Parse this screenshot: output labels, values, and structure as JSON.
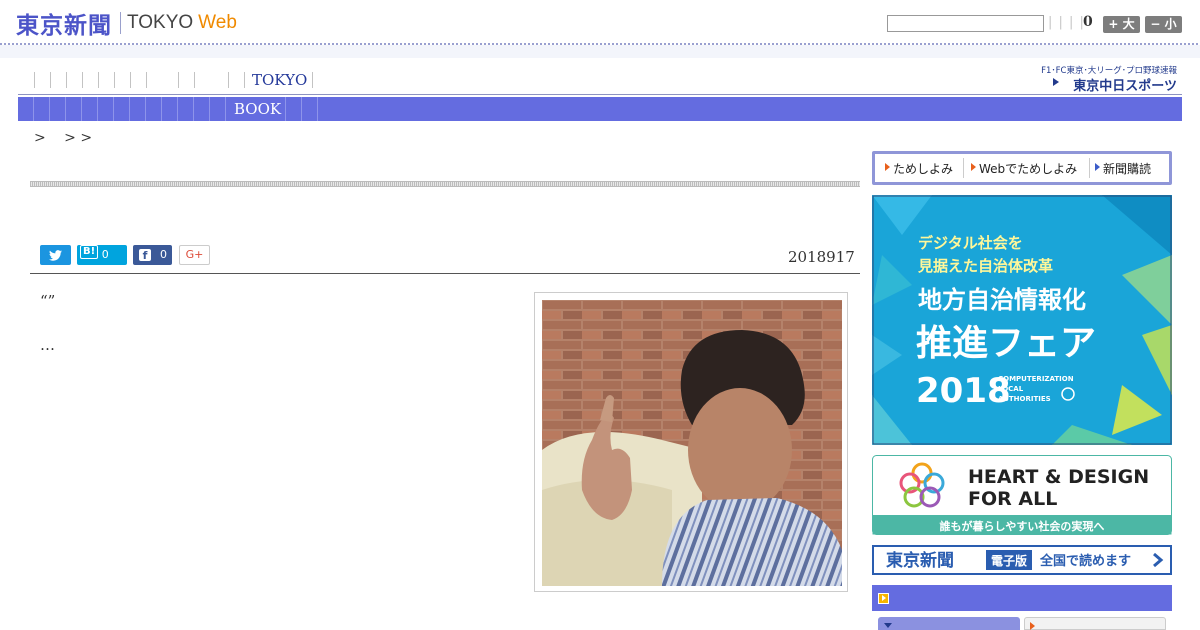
{
  "header": {
    "logo_kanji": "東京新聞",
    "logo_tokyo": "TOKYO",
    "logo_web": "Web",
    "search_placeholder": "",
    "bars": "| | | |",
    "count": "0",
    "font_up_label": "+ 大",
    "font_down_label": "− 小"
  },
  "nav": {
    "tokyo_label": "TOKYO",
    "book_label": "BOOK",
    "sports_line1": "F1･FC東京･大リーグ･プロ野球速報",
    "sports_line2": "東京中日スポーツ"
  },
  "breadcrumb": ">　 > >",
  "share": {
    "twitter_icon": "twitter-icon",
    "hatena_label": "B!",
    "hatena_count": "0",
    "facebook_label": "f",
    "facebook_count": "0",
    "gplus_label": "G+"
  },
  "article": {
    "date": "2018917",
    "para1": "“”",
    "para2": "…"
  },
  "sidebar": {
    "subscribe": {
      "item1": "ためしよみ",
      "item2": "Webでためしよみ",
      "item3": "新聞購読"
    },
    "ad_fair": {
      "line1": "デジタル社会を",
      "line2": "見据えた自治体改革",
      "line3": "地方自治情報化",
      "line4": "推進フェア",
      "year": "2018",
      "en1": "COMPUTERIZATION",
      "en2": "LOCAL",
      "en3": "AUTHORITIES"
    },
    "ad_heart": {
      "line1": "HEART & DESIGN",
      "line2": "FOR ALL",
      "tagline": "誰もが暮らしやすい社会の実現へ"
    },
    "ad_eshimbun": {
      "logo": "東京新聞",
      "badge": "電子版",
      "text": "全国で読めます"
    }
  },
  "colors": {
    "brand_blue": "#4c54c8",
    "nav_bar": "#646ce0",
    "web_orange": "#f08a00"
  }
}
